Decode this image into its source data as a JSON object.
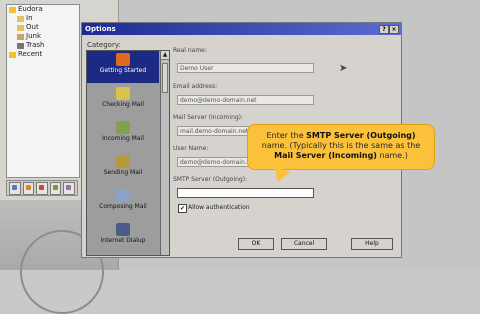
{
  "background_window": {
    "tree": [
      {
        "label": "Eudora",
        "color": "#f2c230"
      },
      {
        "label": "In",
        "color": "#e8c35a"
      },
      {
        "label": "Out",
        "color": "#e8c35a"
      },
      {
        "label": "Junk",
        "color": "#c9a36a"
      },
      {
        "label": "Trash",
        "color": "#777777"
      },
      {
        "label": "Recent",
        "color": "#f2c230"
      }
    ]
  },
  "dialog": {
    "title": "Options",
    "controls": {
      "help": "?",
      "close": "×"
    },
    "category_label": "Category:",
    "categories": [
      {
        "label": "Getting Started",
        "icon": "getting-started-icon",
        "selected": true,
        "color": "#e06a1f"
      },
      {
        "label": "Checking Mail",
        "icon": "checking-mail-icon",
        "selected": false,
        "color": "#d7c24a"
      },
      {
        "label": "Incoming Mail",
        "icon": "incoming-mail-icon",
        "selected": false,
        "color": "#7fa24f"
      },
      {
        "label": "Sending Mail",
        "icon": "sending-mail-icon",
        "selected": false,
        "color": "#b79a3c"
      },
      {
        "label": "Composing Mail",
        "icon": "composing-mail-icon",
        "selected": false,
        "color": "#8aa1c9"
      },
      {
        "label": "Internet Dialup",
        "icon": "internet-dialup-icon",
        "selected": false,
        "color": "#4b5c8a"
      }
    ],
    "fields": {
      "real_name": {
        "label": "Real name:",
        "value": "Demo User"
      },
      "email": {
        "label": "Email address:",
        "value": "demo@demo-domain.net"
      },
      "mail_server": {
        "label": "Mail Server (Incoming):",
        "value": "mail.demo-domain.net"
      },
      "user_name": {
        "label": "User Name:",
        "value": "demo@demo-domain.net"
      },
      "smtp": {
        "label": "SMTP Server (Outgoing):",
        "value": ""
      }
    },
    "allow_auth": {
      "label": "Allow authentication",
      "checked": "✔"
    },
    "buttons": {
      "ok": "OK",
      "cancel": "Cancel",
      "help": "Help"
    }
  },
  "callout": {
    "line1_pre": "Enter the",
    "line1_bold": "SMTP Server (Outgoing)",
    "line2": "name.  (Typically this is the same as the",
    "line3_bold": "Mail Server (Incoming)",
    "line3_post": "name.)"
  },
  "accent_colors": {
    "titlebar": "#1b2b92",
    "callout": "#fbc13a"
  }
}
